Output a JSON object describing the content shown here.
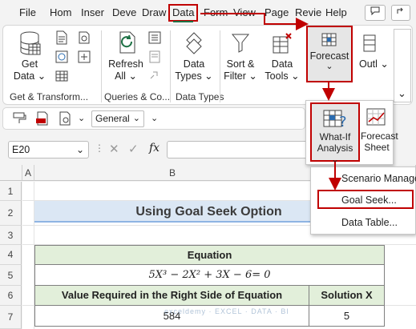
{
  "tabs": [
    {
      "label": "File"
    },
    {
      "label": "Hom"
    },
    {
      "label": "Inser"
    },
    {
      "label": "Deve"
    },
    {
      "label": "Draw"
    },
    {
      "label": "Data"
    },
    {
      "label": "Form"
    },
    {
      "label": "View"
    },
    {
      "label": "Page"
    },
    {
      "label": "Revie"
    },
    {
      "label": "Help"
    }
  ],
  "ribbon": {
    "get_data": {
      "line1": "Get",
      "line2": "Data"
    },
    "refresh_all": {
      "line1": "Refresh",
      "line2": "All"
    },
    "data_types": {
      "line1": "Data",
      "line2": "Types"
    },
    "sort_filter": {
      "line1": "Sort &",
      "line2": "Filter"
    },
    "data_tools": {
      "line1": "Data",
      "line2": "Tools"
    },
    "forecast": {
      "label": "Forecast"
    },
    "outline": {
      "label": "Outl"
    },
    "groups": {
      "get_transform": "Get & Transform...",
      "queries": "Queries & Co...",
      "data_types": "Data Types"
    }
  },
  "quickbar": {
    "number_format": "General"
  },
  "formula_bar": {
    "name_box": "E20",
    "fx": "fx",
    "value": ""
  },
  "columns": {
    "a": "A",
    "b": "B"
  },
  "rows": [
    "1",
    "2",
    "3",
    "4",
    "5",
    "6",
    "7"
  ],
  "sheet": {
    "title": "Using Goal Seek Option",
    "equation_header": "Equation",
    "equation": "5X³ − 2X² + 3X − 6= 0",
    "value_header": "Value Required in the Right Side of Equation",
    "solution_header": "Solution X",
    "value": "584",
    "solution": "5"
  },
  "forecast_popup": {
    "whatif": {
      "line1": "What-If",
      "line2": "Analysis"
    },
    "forecast_sheet": {
      "line1": "Forecast",
      "line2": "Sheet"
    }
  },
  "whatif_menu": {
    "scenario_manager": "Scenario Manager...",
    "goal_seek": "Goal Seek...",
    "data_table": "Data Table..."
  },
  "watermark": "exceldemy · EXCEL · DATA · BI",
  "colors": {
    "highlight": "#c00000",
    "title_fill": "#dbe7f4",
    "header_fill": "#e2efda",
    "accent": "#1e7145"
  }
}
